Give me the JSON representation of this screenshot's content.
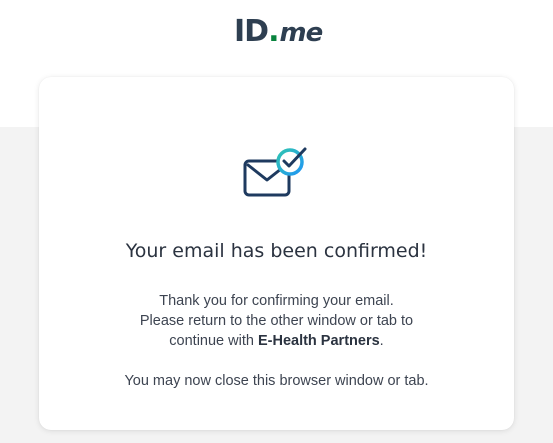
{
  "brand": {
    "logo_main": "ID",
    "logo_dot": ".",
    "logo_suffix": "me",
    "logo_color": "#2e3f51",
    "logo_dot_color": "#08833d"
  },
  "card": {
    "icon": "email-confirmed-icon",
    "title": "Your email has been confirmed!",
    "message_line1": "Thank you for confirming your email.",
    "message_line2": "Please return to the other window or tab to",
    "message_line3_prefix": "continue with ",
    "partner_name": "E-Health Partners",
    "message_line3_suffix": ".",
    "close_message": "You may now close this browser window or tab."
  },
  "colors": {
    "accent_teal": "#2fc4b2",
    "accent_blue": "#2196f3",
    "envelope": "#1e3a5f",
    "background": "#f3f3f3"
  }
}
